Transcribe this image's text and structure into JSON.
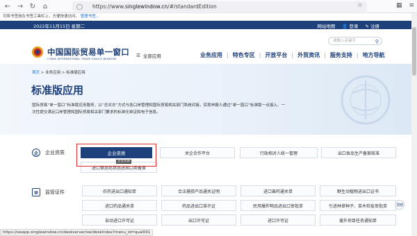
{
  "browser": {
    "url_prefix": "https://www.",
    "url_domain": "singlewindow.cn",
    "url_suffix": "/#/standardEdition"
  },
  "notice": {
    "text": "可将书签放在书签工具栏上，方便快速访问。",
    "link": "管理书签..."
  },
  "topbar": {
    "date": "2022年11月15日 星期二",
    "links": [
      "网站地图",
      "登录",
      "注册"
    ]
  },
  "header": {
    "search_placeholder": "请输入关键字",
    "logo_cn": "中国国际贸易单一窗口",
    "logo_en": "CHINA INTERNATIONAL TRADE SINGLE WINDOW",
    "all_apps": "全部应用",
    "nav": [
      "业务应用",
      "特色专区",
      "开放平台",
      "外贸资讯",
      "服务支持",
      "地方导航"
    ]
  },
  "hero": {
    "breadcrumb": [
      "首页",
      "业务应用",
      "标准版应用"
    ],
    "title": "标准版应用",
    "desc_line1": "国际贸易“单一窗口”标准版应用服务，以“总对总”方式与各口岸管理和国际贸易相关部门系统对接，实现申报人通过“单一窗口”标准版一点接入、一",
    "desc_line2": "次性提交满足口岸管理和国际贸易相关部门要求的标准化单证和电子信息。"
  },
  "sections": {
    "qualification": {
      "label": "企业资质",
      "items": [
        "企业资质",
        "关企合作平台",
        "行政相对人统一管理",
        "出口食品生产备案核准",
        "进口食品化妆品进出口商备案"
      ]
    },
    "license": {
      "label": "监管证件",
      "items": [
        "农药进出口通知单",
        "合法捕捞产品通关证明",
        "进口兽药通关单",
        "野生动植物进出口证书",
        "进口药品通关单",
        "药品进出口准许证",
        "民用爆炸物品进出口审批单",
        "引进林草种子、苗木检疫审批单",
        "自动进口许可证",
        "出口许可证",
        "进口许可证",
        "援外项目任务通知单"
      ]
    },
    "tooltip": "企业资质"
  },
  "back_top": "顶部",
  "status_url": "https://swapp.singlewindow.cn/deskserver/sw/deskIndex?menu_id=qual001"
}
